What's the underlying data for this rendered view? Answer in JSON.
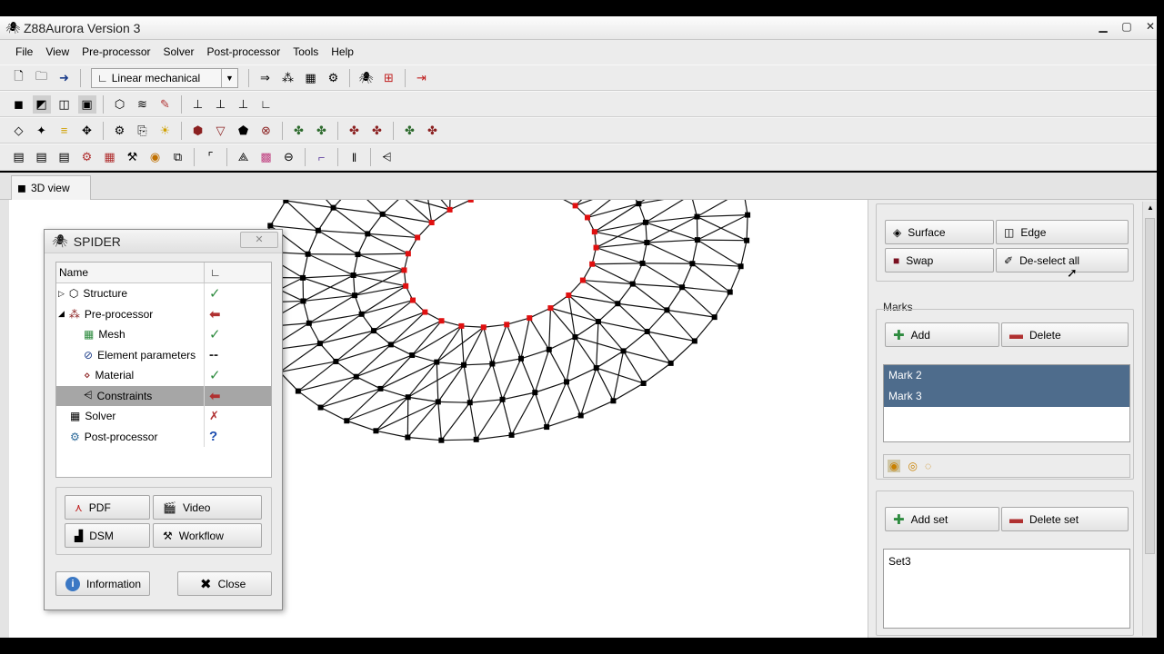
{
  "window": {
    "title": "Z88Aurora Version 3"
  },
  "menu": [
    "File",
    "View",
    "Pre-processor",
    "Solver",
    "Post-processor",
    "Tools",
    "Help"
  ],
  "toolbar": {
    "analysis_type": "Linear mechanical"
  },
  "tabs": [
    {
      "label": "3D view"
    }
  ],
  "spider": {
    "title": "SPIDER",
    "col_name": "Name",
    "rows": [
      {
        "label": "Structure",
        "icon": "structure-icon",
        "status": "✓"
      },
      {
        "label": "Pre-processor",
        "icon": "preprocessor-icon",
        "status": "⬅"
      },
      {
        "label": "Mesh",
        "icon": "mesh-icon",
        "status": "✓"
      },
      {
        "label": "Element parameters",
        "icon": "element-parameters-icon",
        "status": "--"
      },
      {
        "label": "Material",
        "icon": "material-icon",
        "status": "✓"
      },
      {
        "label": "Constraints",
        "icon": "constraints-icon",
        "status": "⬅"
      },
      {
        "label": "Solver",
        "icon": "solver-icon",
        "status": "✗"
      },
      {
        "label": "Post-processor",
        "icon": "postprocessor-icon",
        "status": "?"
      }
    ],
    "buttons": {
      "pdf": "PDF",
      "video": "Video",
      "dsm": "DSM",
      "workflow": "Workflow",
      "information": "Information",
      "close": "Close"
    }
  },
  "panel": {
    "surface": "Surface",
    "edge": "Edge",
    "swap": "Swap",
    "deselect_all": "De-select all",
    "marks_label": "Marks",
    "add": "Add",
    "delete": "Delete",
    "marks": [
      "Mark 2",
      "Mark 3"
    ],
    "add_set": "Add set",
    "delete_set": "Delete set",
    "sets": [
      "Set3"
    ]
  },
  "colors": {
    "selected_row": "#4e6c8c",
    "marked_node": "#e01010",
    "ok": "#2e8b3f",
    "back": "#b03030"
  }
}
